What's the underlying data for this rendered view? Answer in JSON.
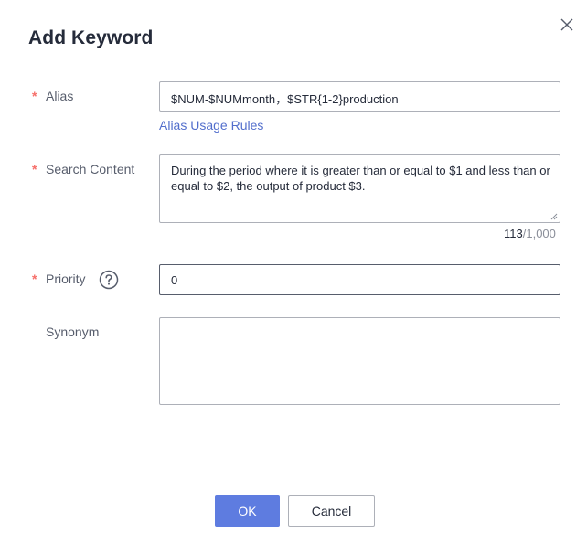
{
  "dialog": {
    "title": "Add Keyword"
  },
  "form": {
    "alias": {
      "label": "Alias",
      "required_mark": "*",
      "value": "$NUM-$NUMmonth，$STR{1-2}production",
      "link": "Alias Usage Rules"
    },
    "search_content": {
      "label": "Search Content",
      "required_mark": "*",
      "value": "During the period where it is greater than or equal to $1 and less than or equal to $2, the output of product $3.",
      "count_current": "113",
      "count_max": "/1,000"
    },
    "priority": {
      "label": "Priority",
      "required_mark": "*",
      "value": "0",
      "help_icon": "question-circle"
    },
    "synonym": {
      "label": "Synonym",
      "value": ""
    }
  },
  "buttons": {
    "ok": "OK",
    "cancel": "Cancel"
  },
  "colors": {
    "primary": "#5e7ce0",
    "link": "#526ecc",
    "required": "#f66f6a",
    "border": "#adb0b8"
  }
}
